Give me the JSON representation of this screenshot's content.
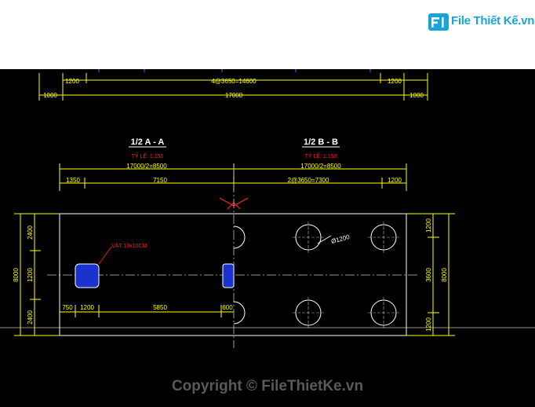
{
  "brand": {
    "logo_text": "File Thiết Kế.vn",
    "logo_icon": "file-logo-icon",
    "logo_color": "#1aa3d9"
  },
  "drawing": {
    "top_dims": {
      "d1": "1200",
      "d2": "4@3650=14600",
      "d3": "1200",
      "d4": "1000",
      "d5": "17000",
      "d6": "1000"
    },
    "section_a": {
      "title": "1/2 A - A",
      "scale": "TỶ LỆ: 1:150",
      "half": "17000/2=8500",
      "d1": "1350",
      "d2": "7150"
    },
    "section_b": {
      "title": "1/2 B - B",
      "scale": "TỶ LỆ: 1:150",
      "half": "17000/2=8500",
      "d1": "2@3650=7300",
      "d2": "1200"
    },
    "left_dims": {
      "total": "8000",
      "d1": "2400",
      "d2": "1200",
      "d3": "2400"
    },
    "right_dims": {
      "total": "8000",
      "d1": "1200",
      "d2": "3600",
      "d3": "1200"
    },
    "pile_label": "Ø1200",
    "opening_label": "VÁT 10x10CM",
    "bottom_dims": {
      "d1": "750",
      "d2": "1200",
      "d3": "5850",
      "d4": "600"
    },
    "colors": {
      "line": "#ffffff",
      "dim": "#ffff00",
      "text_red": "#ff2020",
      "text_yellow": "#ffff00",
      "opening": "#0000ff"
    }
  },
  "footer": {
    "copyright": "Copyright © FileThietKe.vn"
  }
}
